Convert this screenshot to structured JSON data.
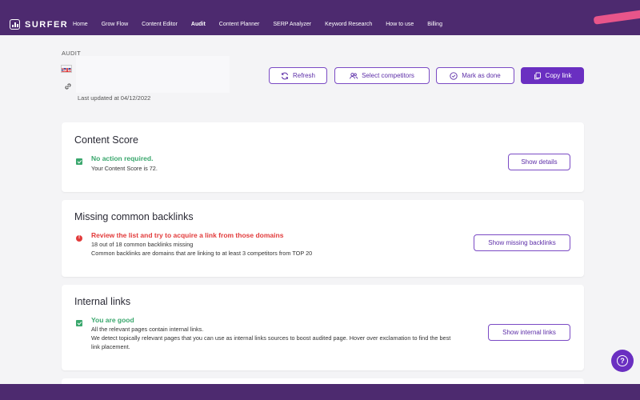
{
  "brand": {
    "name": "SURFER",
    "accent": "#e8558a",
    "nav_bg": "#4d2a6f",
    "primary": "#6a2fc1"
  },
  "nav": [
    {
      "label": "Home",
      "active": false
    },
    {
      "label": "Grow Flow",
      "active": false
    },
    {
      "label": "Content Editor",
      "active": false
    },
    {
      "label": "Audit",
      "active": true
    },
    {
      "label": "Content Planner",
      "active": false
    },
    {
      "label": "SERP Analyzer",
      "active": false
    },
    {
      "label": "Keyword Research",
      "active": false
    },
    {
      "label": "How to use",
      "active": false
    },
    {
      "label": "Billing",
      "active": false
    }
  ],
  "header": {
    "section_label": "AUDIT",
    "flag_icon": "uk-flag-icon",
    "link_icon": "link-icon",
    "last_updated": "Last updated at 04/12/2022"
  },
  "actions": {
    "refresh": "Refresh",
    "select_competitors": "Select competitors",
    "mark_as_done": "Mark as done",
    "copy_link": "Copy link"
  },
  "cards": {
    "content_score": {
      "title": "Content Score",
      "status": "ok",
      "status_title": "No action required.",
      "lines": [
        "Your Content Score is 72."
      ],
      "button": "Show details"
    },
    "backlinks": {
      "title": "Missing common backlinks",
      "status": "error",
      "status_title": "Review the list and try to acquire a link from those domains",
      "lines": [
        "18 out of 18 common backlinks missing",
        "Common backlinks are domains that are linking to at least 3 competitors from TOP 20"
      ],
      "button": "Show missing backlinks"
    },
    "internal_links": {
      "title": "Internal links",
      "status": "ok",
      "status_title": "You are good",
      "lines": [
        "All the relevant pages contain internal links.",
        "We detect topically relevant pages that you can use as internal links sources to boost audited page. Hover over exclamation to find the best",
        "link placement."
      ],
      "button": "Show internal links"
    }
  },
  "help_icon": "question-icon"
}
